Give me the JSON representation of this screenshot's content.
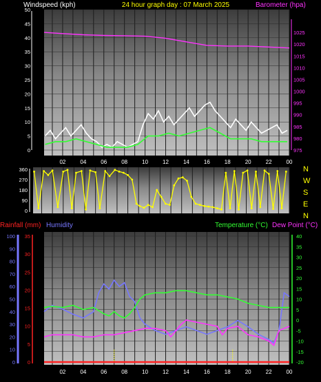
{
  "colors": {
    "windspeed_gust": "#ffffff",
    "windspeed_avg": "#33ff33",
    "barometer": "#ff33ff",
    "direction": "#ffff00",
    "rainfall": "#ff2222",
    "humidity": "#7777ff",
    "temperature": "#33ff33",
    "dewpoint": "#ff33ff",
    "title": "#ffff00"
  },
  "chart_data": [
    {
      "type": "line",
      "title": "24 hour graph day : 07 March 2025",
      "ylabel": "Windspeed (kph)",
      "y2label": "Barometer (hpa)",
      "ylim": [
        0,
        50
      ],
      "y2lim": [
        975,
        1030
      ],
      "yticks": [
        "0",
        "5",
        "10",
        "15",
        "20",
        "25",
        "30",
        "35",
        "40",
        "45",
        "50"
      ],
      "y2ticks": [
        "975",
        "980",
        "985",
        "990",
        "995",
        "1000",
        "1005",
        "1010",
        "1015",
        "1020",
        "1025"
      ],
      "xticks": [
        "02",
        "04",
        "06",
        "08",
        "10",
        "12",
        "14",
        "16",
        "18",
        "20",
        "22",
        "00"
      ],
      "xlim": [
        0.2,
        24
      ],
      "series": [
        {
          "name": "Windspeed (kph)",
          "axis": "left",
          "style": "gust",
          "x": [
            0.3,
            0.8,
            1.3,
            1.8,
            2.3,
            2.8,
            3.3,
            3.8,
            4.3,
            4.8,
            5.3,
            5.8,
            6.3,
            6.8,
            7.3,
            7.8,
            8.3,
            8.8,
            9.3,
            9.8,
            10.3,
            10.8,
            11.3,
            11.8,
            12.3,
            12.8,
            13.3,
            13.8,
            14.3,
            14.8,
            15.3,
            15.8,
            16.3,
            16.8,
            17.3,
            17.8,
            18.3,
            18.8,
            19.3,
            19.8,
            20.3,
            20.8,
            21.3,
            21.8,
            22.3,
            22.8,
            23.3,
            23.8
          ],
          "y": [
            5,
            7,
            4,
            6,
            8,
            5,
            7,
            9,
            6,
            4,
            3,
            1,
            2,
            1,
            3,
            2,
            1,
            2,
            3,
            9,
            13,
            11,
            14,
            10,
            12,
            9,
            11,
            13,
            15,
            12,
            14,
            16,
            17,
            14,
            12,
            10,
            8,
            11,
            9,
            7,
            10,
            8,
            6,
            7,
            8,
            9,
            6,
            7
          ]
        },
        {
          "name": "Windspeed avg",
          "axis": "left",
          "style": "avg",
          "x": [
            0.3,
            1.3,
            2.3,
            3.3,
            4.3,
            5.3,
            6.3,
            7.3,
            8.3,
            9.3,
            10.3,
            11.3,
            12.3,
            13.3,
            14.3,
            15.3,
            16.3,
            17.3,
            18.3,
            19.3,
            20.3,
            21.3,
            22.3,
            23.3,
            23.8
          ],
          "y": [
            2,
            3,
            3,
            4,
            3,
            2,
            1,
            1,
            1,
            2,
            5,
            5,
            6,
            5,
            6,
            7,
            8,
            6,
            4,
            4,
            4,
            3,
            3,
            3,
            3
          ]
        },
        {
          "name": "Barometer (hpa)",
          "axis": "right",
          "x": [
            0.2,
            2,
            4,
            6,
            8,
            10,
            12,
            14,
            16,
            18,
            20,
            22,
            24
          ],
          "y": [
            1025,
            1024.5,
            1024,
            1023.7,
            1023.6,
            1023.4,
            1022.5,
            1021,
            1019.5,
            1019.2,
            1019.2,
            1018.8,
            1018.4
          ]
        }
      ]
    },
    {
      "type": "scatter",
      "ylim": [
        0,
        360
      ],
      "yticks": [
        "0",
        "90",
        "180",
        "270",
        "360"
      ],
      "direction_labels": [
        "N",
        "W",
        "S",
        "E",
        "N"
      ],
      "xlim": [
        0.2,
        24
      ],
      "series": [
        {
          "name": "Wind direction",
          "axis": "left",
          "x": [
            0.3,
            0.7,
            1.2,
            1.6,
            2.0,
            2.5,
            3.0,
            3.4,
            3.8,
            4.2,
            4.7,
            5.1,
            5.5,
            6.0,
            6.4,
            6.9,
            7.3,
            7.8,
            8.2,
            8.6,
            9.0,
            9.4,
            9.8,
            10.1,
            10.5,
            10.9,
            11.3,
            11.7,
            12.1,
            12.5,
            12.9,
            13.3,
            13.7,
            14.1,
            14.5,
            14.9,
            15.3,
            15.7,
            16.1,
            16.5,
            16.9,
            17.3,
            17.7,
            18.1,
            18.5,
            18.9,
            19.3,
            19.7,
            20.1,
            20.5,
            20.9,
            21.3,
            21.7,
            22.1,
            22.5,
            22.9,
            23.3,
            23.7
          ],
          "y": [
            340,
            20,
            345,
            310,
            350,
            30,
            340,
            355,
            20,
            330,
            345,
            10,
            350,
            335,
            20,
            345,
            300,
            355,
            340,
            330,
            310,
            270,
            60,
            40,
            25,
            50,
            30,
            180,
            120,
            60,
            50,
            220,
            280,
            290,
            260,
            120,
            60,
            50,
            40,
            35,
            30,
            20,
            10,
            330,
            20,
            345,
            10,
            330,
            350,
            20,
            340,
            30,
            350,
            320,
            15,
            345,
            20,
            340
          ]
        }
      ]
    },
    {
      "type": "line",
      "ylabel": "Rainfall (mm)",
      "y2label": "Temperature (°C)",
      "ylabel_b": "Humidity",
      "y2label_b": "Dew Point (°C)",
      "humidity_lim": [
        0,
        100
      ],
      "rain_lim": [
        0,
        35
      ],
      "temp_lim": [
        -20,
        40
      ],
      "humidity_ticks": [
        "0",
        "10",
        "20",
        "30",
        "40",
        "50",
        "60",
        "70",
        "80",
        "90",
        "100"
      ],
      "rain_ticks": [
        "0",
        "5",
        "10",
        "15",
        "20",
        "25",
        "30",
        "35"
      ],
      "temp_ticks": [
        "-20",
        "-15",
        "-10",
        "-5",
        "0",
        "5",
        "10",
        "15",
        "20",
        "25",
        "30",
        "35",
        "40"
      ],
      "xticks": [
        "02",
        "04",
        "06",
        "08",
        "10",
        "12",
        "14",
        "16",
        "18",
        "20",
        "22",
        "00"
      ],
      "xlim": [
        0.2,
        24
      ],
      "series": [
        {
          "name": "Rainfall (mm)",
          "axis": "rain",
          "x": [
            0.2,
            24
          ],
          "y": [
            0,
            0
          ]
        },
        {
          "name": "Humidity",
          "axis": "humidity",
          "x": [
            0.2,
            1,
            2,
            3,
            4,
            5,
            5.5,
            6,
            6.5,
            7,
            7.5,
            8,
            8.5,
            9,
            9.5,
            10,
            11,
            12,
            13,
            14,
            15,
            16,
            17,
            18,
            19,
            20,
            21,
            22,
            22.5,
            23,
            23.5,
            24
          ],
          "y": [
            40,
            45,
            42,
            38,
            35,
            40,
            55,
            62,
            58,
            65,
            60,
            63,
            52,
            48,
            35,
            30,
            25,
            22,
            25,
            28,
            25,
            22,
            25,
            28,
            33,
            28,
            22,
            18,
            15,
            25,
            55,
            52
          ]
        },
        {
          "name": "Temperature (°C)",
          "axis": "temp",
          "x": [
            0.2,
            1,
            2,
            3,
            4,
            5,
            6,
            6.5,
            7,
            7.5,
            8,
            8.5,
            9,
            9.5,
            10,
            11,
            12,
            13,
            14,
            15,
            16,
            17,
            18,
            19,
            20,
            21,
            22,
            23,
            24
          ],
          "y": [
            6,
            6.5,
            6,
            7,
            5,
            6,
            3,
            2,
            4,
            2,
            1,
            3,
            6,
            10,
            12,
            13,
            13,
            14,
            14,
            13,
            12,
            12,
            11,
            10,
            8,
            7,
            6,
            6,
            6
          ]
        },
        {
          "name": "Dew Point (°C)",
          "axis": "temp",
          "x": [
            0.2,
            1,
            2,
            3,
            4,
            5,
            6,
            7,
            8,
            9,
            10,
            11,
            12,
            12.5,
            13,
            13.5,
            14,
            15,
            16,
            17,
            17.5,
            18,
            19,
            20,
            21,
            22,
            22.5,
            23,
            24
          ],
          "y": [
            -8,
            -7,
            -7,
            -7,
            -8,
            -8,
            -7,
            -7,
            -6,
            -5,
            -4,
            -4,
            -5,
            -8,
            -5,
            -2,
            0,
            -1,
            -2,
            -3,
            -7,
            -4,
            -3,
            -7,
            -8,
            -10,
            -12,
            -5,
            -3
          ]
        }
      ],
      "rain_markers_x": [
        7,
        18.5
      ]
    }
  ]
}
